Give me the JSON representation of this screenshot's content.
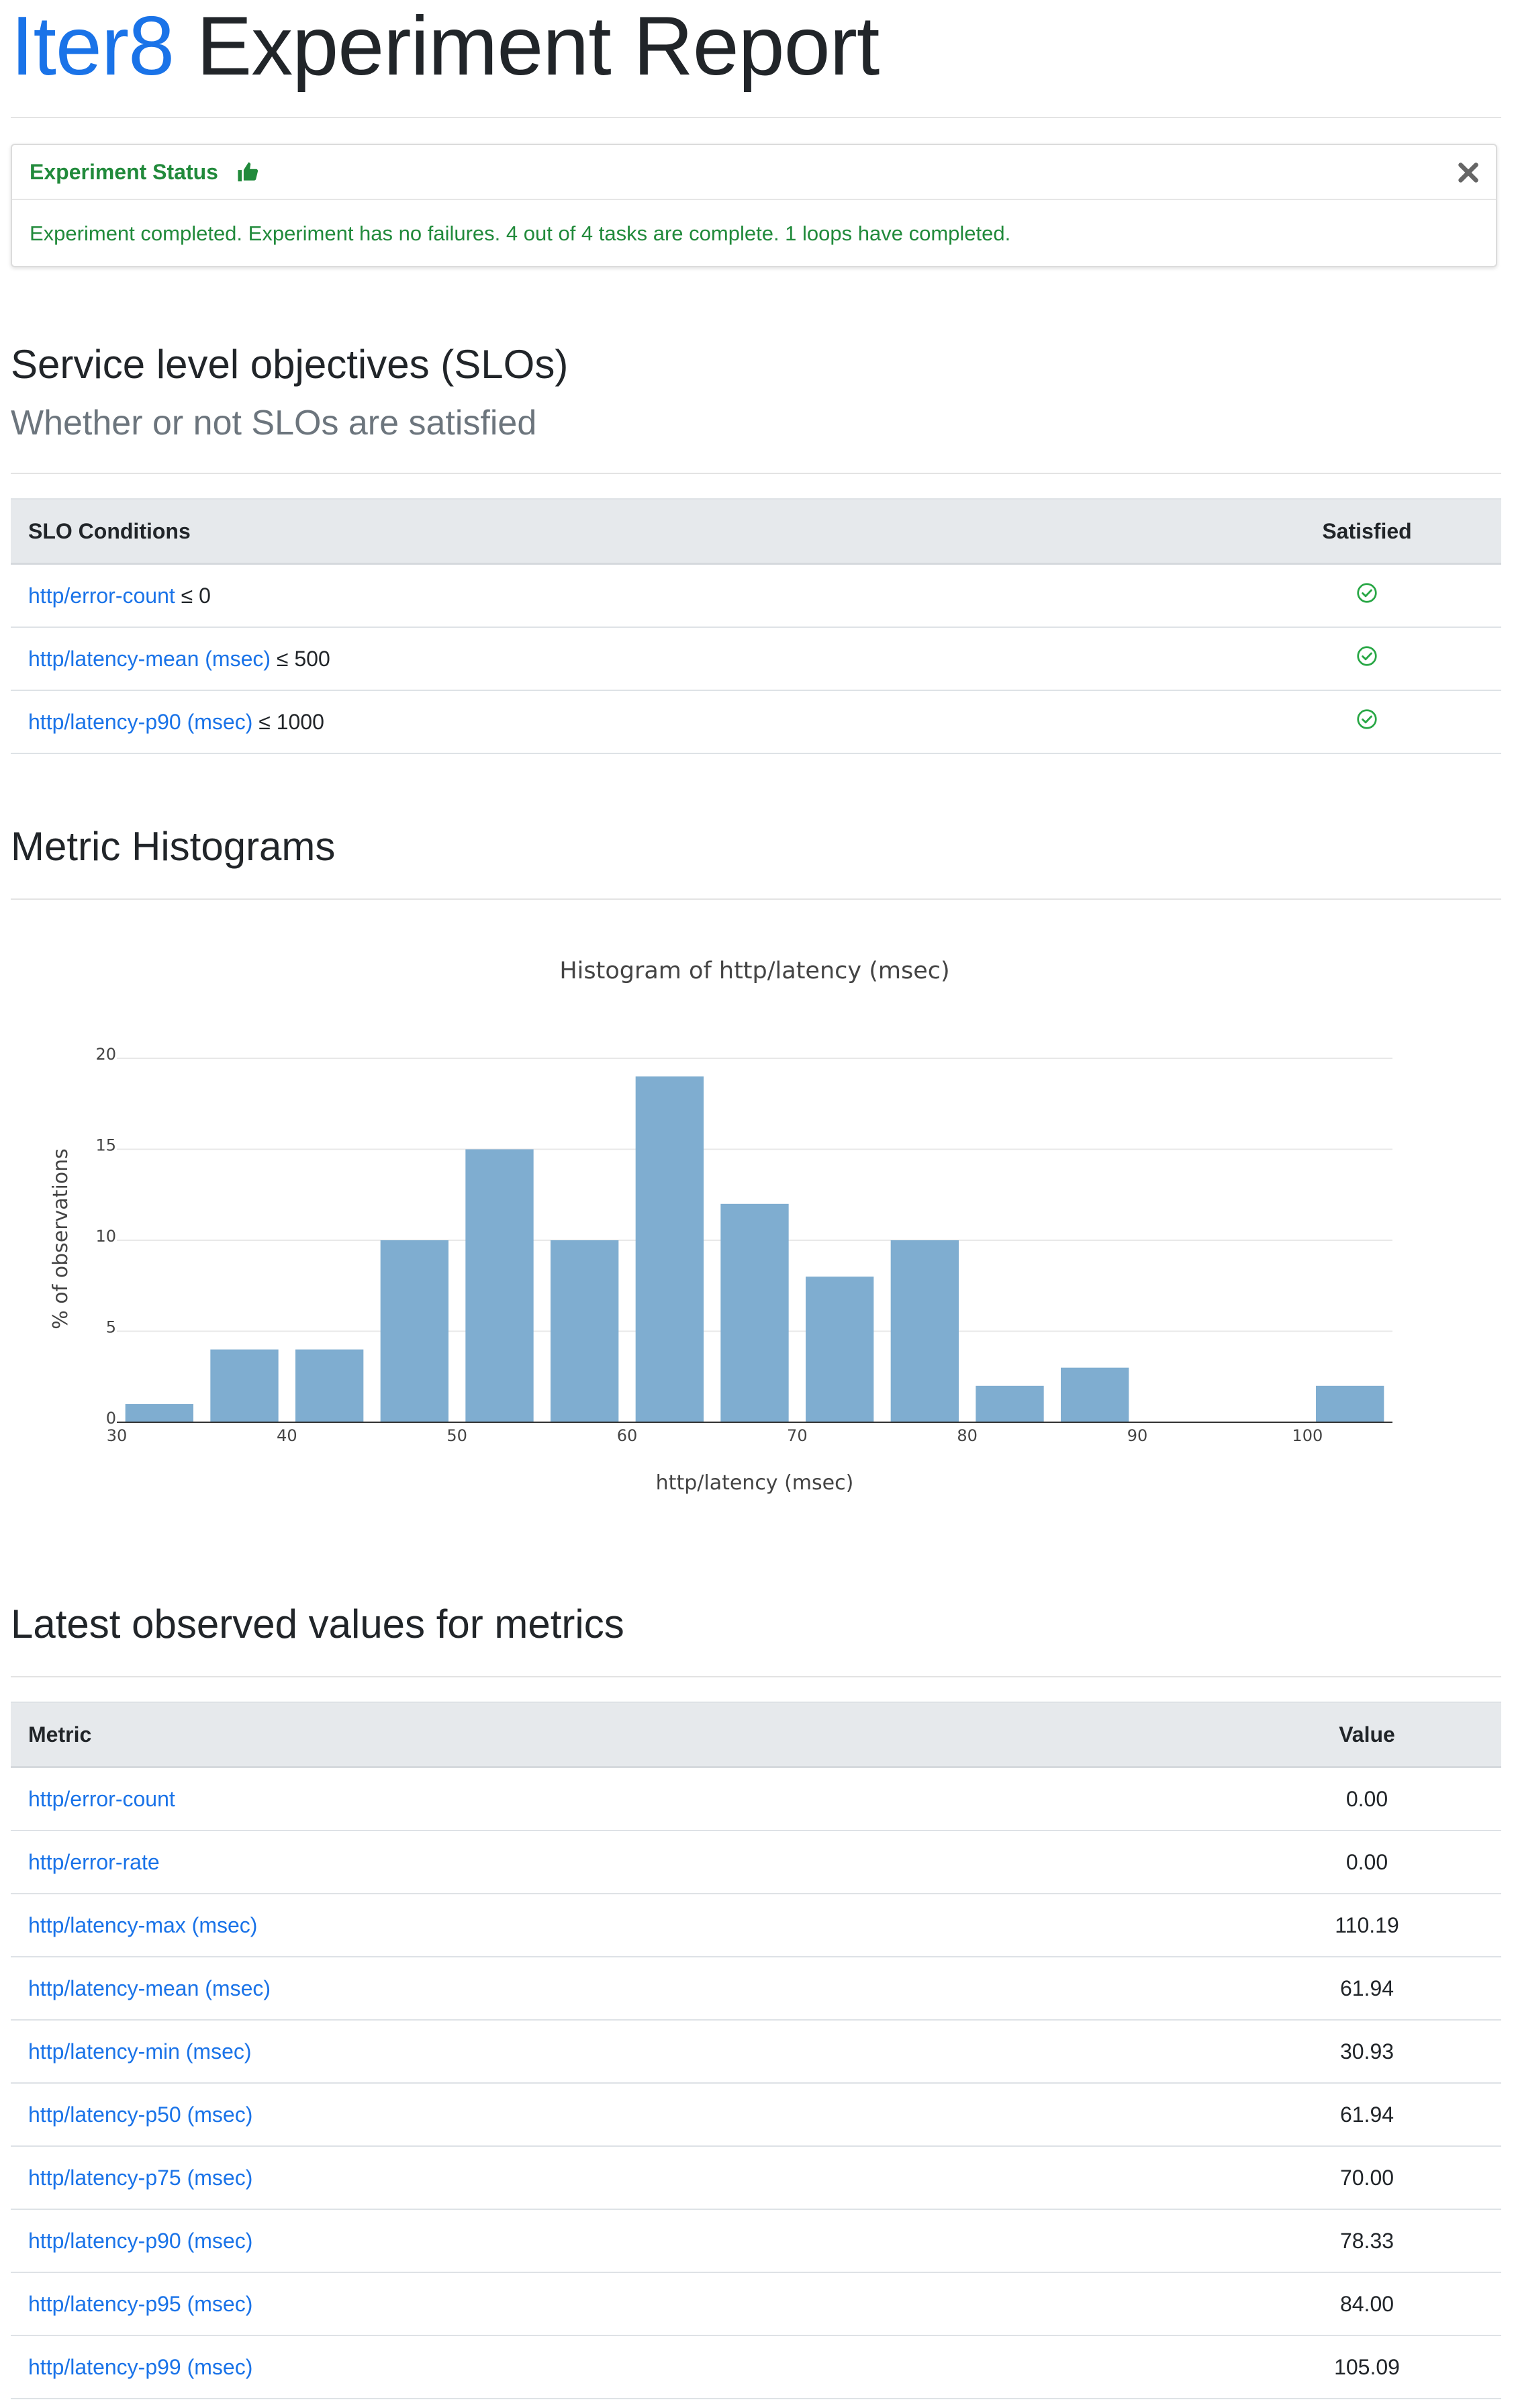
{
  "header": {
    "brand": "Iter8",
    "title": "Experiment Report"
  },
  "status": {
    "heading": "Experiment Status",
    "message": "Experiment completed. Experiment has no failures. 4 out of 4 tasks are complete. 1 loops have completed.",
    "color": "#218a3b"
  },
  "slo": {
    "title": "Service level objectives (SLOs)",
    "subtitle": "Whether or not SLOs are satisfied",
    "columns": [
      "SLO Conditions",
      "Satisfied"
    ],
    "rows": [
      {
        "metric": "http/error-count",
        "condition": "≤ 0",
        "satisfied": true
      },
      {
        "metric": "http/latency-mean (msec)",
        "condition": "≤ 500",
        "satisfied": true
      },
      {
        "metric": "http/latency-p90 (msec)",
        "condition": "≤ 1000",
        "satisfied": true
      }
    ]
  },
  "histograms": {
    "title": "Metric Histograms"
  },
  "chart_data": {
    "type": "bar",
    "title": "Histogram of http/latency (msec)",
    "xlabel": "http/latency (msec)",
    "ylabel": "% of observations",
    "bins": [
      {
        "x0": 30,
        "x1": 35,
        "y": 1
      },
      {
        "x0": 35,
        "x1": 40,
        "y": 4
      },
      {
        "x0": 40,
        "x1": 45,
        "y": 4
      },
      {
        "x0": 45,
        "x1": 50,
        "y": 10
      },
      {
        "x0": 50,
        "x1": 55,
        "y": 15
      },
      {
        "x0": 55,
        "x1": 60,
        "y": 10
      },
      {
        "x0": 60,
        "x1": 65,
        "y": 19
      },
      {
        "x0": 65,
        "x1": 70,
        "y": 12
      },
      {
        "x0": 70,
        "x1": 75,
        "y": 8
      },
      {
        "x0": 75,
        "x1": 80,
        "y": 10
      },
      {
        "x0": 80,
        "x1": 85,
        "y": 2
      },
      {
        "x0": 85,
        "x1": 90,
        "y": 3
      },
      {
        "x0": 100,
        "x1": 105,
        "y": 2
      }
    ],
    "xlim": [
      30,
      105
    ],
    "ylim": [
      0,
      20
    ],
    "xticks": [
      "30",
      "40",
      "50",
      "60",
      "70",
      "80",
      "90",
      "100"
    ],
    "yticks": [
      "0",
      "5",
      "10",
      "15",
      "20"
    ],
    "bar_color": "#7fadd0",
    "grid": true
  },
  "latest": {
    "title": "Latest observed values for metrics",
    "columns": [
      "Metric",
      "Value"
    ],
    "rows": [
      {
        "metric": "http/error-count",
        "value": "0.00"
      },
      {
        "metric": "http/error-rate",
        "value": "0.00"
      },
      {
        "metric": "http/latency-max (msec)",
        "value": "110.19"
      },
      {
        "metric": "http/latency-mean (msec)",
        "value": "61.94"
      },
      {
        "metric": "http/latency-min (msec)",
        "value": "30.93"
      },
      {
        "metric": "http/latency-p50 (msec)",
        "value": "61.94"
      },
      {
        "metric": "http/latency-p75 (msec)",
        "value": "70.00"
      },
      {
        "metric": "http/latency-p90 (msec)",
        "value": "78.33"
      },
      {
        "metric": "http/latency-p95 (msec)",
        "value": "84.00"
      },
      {
        "metric": "http/latency-p99 (msec)",
        "value": "105.09"
      }
    ]
  }
}
